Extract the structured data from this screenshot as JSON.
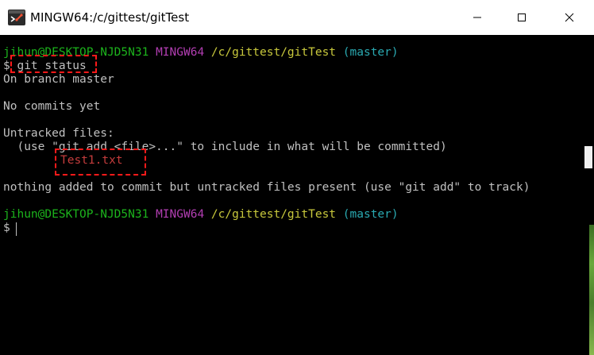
{
  "window": {
    "title": "MINGW64:/c/gittest/gitTest",
    "icons": {
      "app": "git-bash-icon",
      "minimize": "minimize-icon",
      "maximize": "maximize-icon",
      "close": "close-icon"
    }
  },
  "terminal": {
    "prompt1": {
      "user_host": "jihun@DESKTOP-NJD5N31",
      "shell": "MINGW64",
      "path": "/c/gittest/gitTest",
      "branch": "(master)"
    },
    "command": "$ git status",
    "output": [
      "On branch master",
      "",
      "No commits yet",
      "",
      "Untracked files:",
      "  (use \"git add <file>...\" to include in what will be committed)",
      "Test1.txt",
      "",
      "nothing added to commit but untracked files present (use \"git add\" to track)"
    ],
    "prompt2": {
      "user_host": "jihun@DESKTOP-NJD5N31",
      "shell": "MINGW64",
      "path": "/c/gittest/gitTest",
      "branch": "(master)"
    },
    "input_prompt": "$ "
  },
  "colors": {
    "user_host": "#1cb31c",
    "shell": "#b23eb2",
    "path": "#c8c83c",
    "branch": "#2aaab2",
    "untracked_file": "#c43c3c",
    "highlight_box": "#ff1a1a"
  }
}
